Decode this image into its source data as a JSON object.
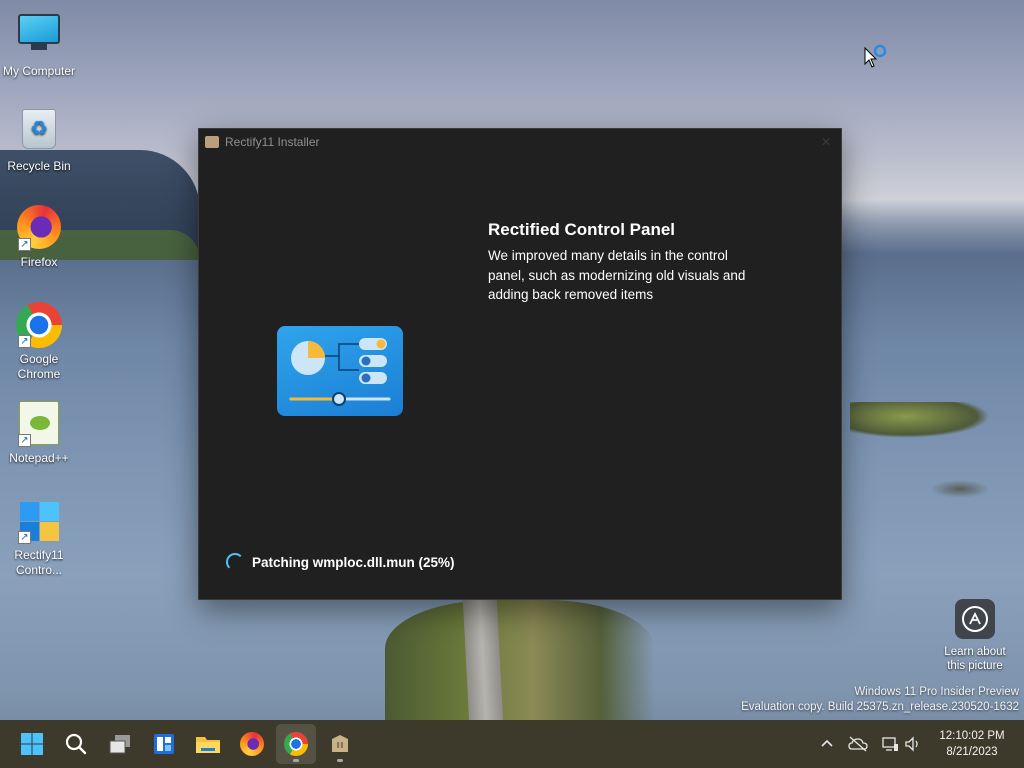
{
  "desktop": {
    "icons": [
      {
        "label": "My Computer",
        "icon": "monitor-icon"
      },
      {
        "label": "Recycle Bin",
        "icon": "recycle-bin-icon"
      },
      {
        "label": "Firefox",
        "icon": "firefox-icon"
      },
      {
        "label": "Google Chrome",
        "icon": "chrome-icon"
      },
      {
        "label": "Notepad++",
        "icon": "notepad-plus-plus-icon"
      },
      {
        "label": "Rectify11 Contro...",
        "icon": "rectify11-icon"
      }
    ],
    "learn_about_label": "Learn about this picture",
    "watermark_line1": "Windows 11 Pro Insider Preview",
    "watermark_line2": "Evaluation copy. Build 25375.zn_release.230520-1632"
  },
  "installer": {
    "title": "Rectify11 Installer",
    "feature_title": "Rectified Control Panel",
    "feature_description": "We improved many details in the control panel, such as modernizing old visuals and adding back removed items",
    "status_text": "Patching wmploc.dll.mun (25%)",
    "progress_percent": 25
  },
  "taskbar": {
    "items": [
      {
        "name": "start",
        "icon": "windows-start-icon"
      },
      {
        "name": "search",
        "icon": "search-icon"
      },
      {
        "name": "task-view",
        "icon": "task-view-icon"
      },
      {
        "name": "widgets",
        "icon": "widgets-icon"
      },
      {
        "name": "file-explorer",
        "icon": "folder-icon"
      },
      {
        "name": "firefox",
        "icon": "firefox-icon"
      },
      {
        "name": "chrome",
        "icon": "chrome-icon",
        "active": true
      },
      {
        "name": "installer",
        "icon": "installer-icon"
      }
    ],
    "tray": {
      "time": "12:10:02 PM",
      "date": "8/21/2023"
    }
  },
  "colors": {
    "window_bg": "#202020",
    "taskbar_bg": "#3d3a2c",
    "accent": "#4cc2ff"
  }
}
